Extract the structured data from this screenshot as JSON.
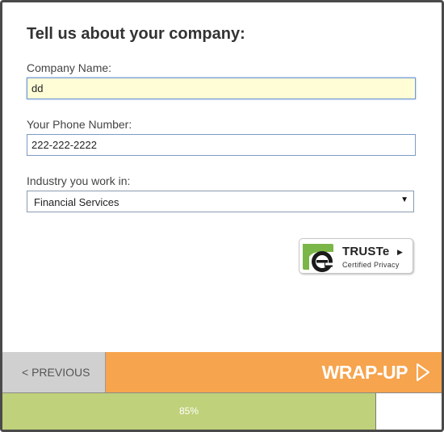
{
  "form": {
    "title": "Tell us about your company:",
    "company_name": {
      "label": "Company Name:",
      "value": "dd"
    },
    "phone": {
      "label": "Your Phone Number:",
      "value": "222-222-2222"
    },
    "industry": {
      "label": "Industry you work in:",
      "selected": "Financial Services"
    }
  },
  "badge": {
    "name": "TRUSTe",
    "subtitle": "Certified Privacy",
    "logo_icon": "truste-e-icon",
    "accent_color": "#7ab648"
  },
  "navigation": {
    "previous_label": "< PREVIOUS",
    "next_label": "WRAP-UP",
    "next_icon": "play-outline-icon",
    "next_color": "#f6a44d",
    "previous_color": "#d0d0d0"
  },
  "progress": {
    "percent": 85,
    "label": "85%",
    "fill_color": "#bfd17a"
  }
}
